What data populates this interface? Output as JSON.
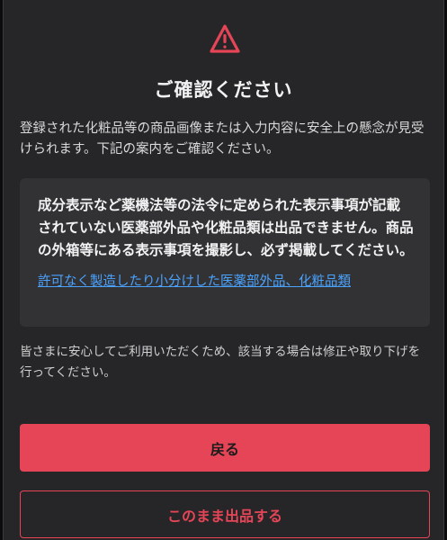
{
  "dialog": {
    "icon": "warning-triangle-icon",
    "title": "ご確認ください",
    "description": "登録された化粧品等の商品画像または入力内容に安全上の懸念が見受けられます。下記の案内をご確認ください。",
    "notice": {
      "text": "成分表示など薬機法等の法令に定められた表示事項が記載されていない医薬部外品や化粧品類は出品できません。商品の外箱等にある表示事項を撮影し、必ず掲載してください。",
      "link_label": "許可なく製造したり小分けした医薬部外品、化粧品類"
    },
    "footer_note": "皆さまに安心してご利用いただくため、該当する場合は修正や取り下げを行ってください。",
    "back_button_label": "戻る",
    "proceed_button_label": "このまま出品する"
  },
  "colors": {
    "accent": "#e54556",
    "link": "#4aa3ff",
    "background": "#262629",
    "notice_box": "#323235"
  }
}
